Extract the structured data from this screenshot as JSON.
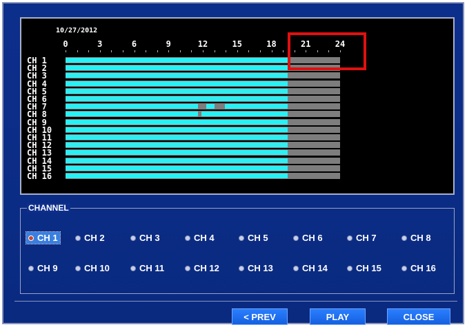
{
  "timeline": {
    "date": "10/27/2012",
    "hour_ticks": [
      "0",
      "3",
      "6",
      "9",
      "12",
      "15",
      "18",
      "21",
      "24"
    ],
    "channels": [
      "CH 1",
      "CH 2",
      "CH 3",
      "CH 4",
      "CH 5",
      "CH 6",
      "CH 7",
      "CH 8",
      "CH 9",
      "CH 10",
      "CH 11",
      "CH 12",
      "CH 13",
      "CH 14",
      "CH 15",
      "CH 16"
    ],
    "recording_color": "#2af0f4",
    "gap_color": "#7d7d7d",
    "highlight_color": "#e01010",
    "recorded_until_hour": 19.4,
    "gray_until_hour": 24,
    "gaps": [
      {
        "channel": 7,
        "start_hour": 11.6,
        "end_hour": 12.3
      },
      {
        "channel": 7,
        "start_hour": 13.0,
        "end_hour": 13.9
      },
      {
        "channel": 8,
        "start_hour": 11.6,
        "end_hour": 11.9
      }
    ]
  },
  "channel_panel": {
    "title": "CHANNEL",
    "selected": "CH 1",
    "options": [
      "CH 1",
      "CH 2",
      "CH 3",
      "CH 4",
      "CH 5",
      "CH 6",
      "CH 7",
      "CH 8",
      "CH 9",
      "CH 10",
      "CH 11",
      "CH 12",
      "CH 13",
      "CH 14",
      "CH 15",
      "CH 16"
    ]
  },
  "buttons": {
    "prev": "< PREV",
    "play": "PLAY",
    "close": "CLOSE"
  }
}
